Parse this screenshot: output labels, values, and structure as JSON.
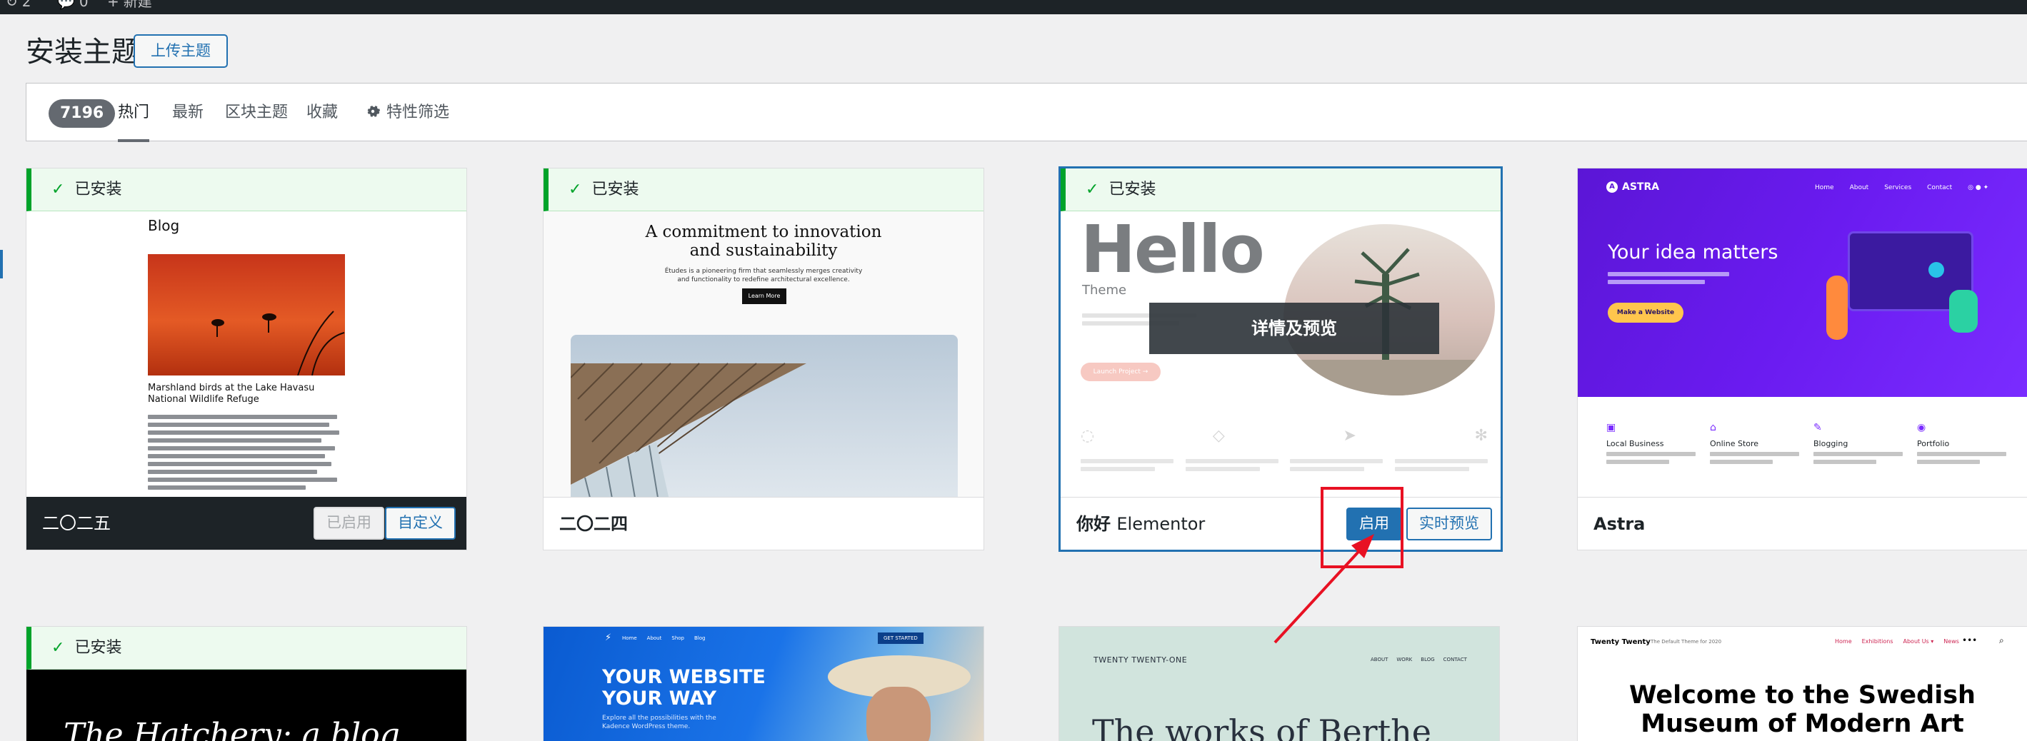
{
  "adminbar": {
    "item1": "2",
    "item2": "0",
    "new_label": "新建"
  },
  "header": {
    "title": "安装主题",
    "upload_label": "上传主题"
  },
  "filters": {
    "count": "7196",
    "tabs": [
      "热门",
      "最新",
      "区块主题",
      "收藏"
    ],
    "feature_filter": "特性筛选"
  },
  "colors": {
    "accent": "#2271b1",
    "installed_green": "#00a32a",
    "highlight_red": "#e81123"
  },
  "common": {
    "installed_label": "已安装",
    "overlay_label": "详情及预览"
  },
  "cards": [
    {
      "name": "二〇二五",
      "btn_activated": "已启用",
      "btn_customize": "自定义",
      "preview": {
        "heading": "Blog",
        "caption": "Marshland birds at the Lake Havasu National Wildlife Refuge"
      }
    },
    {
      "name": "二〇二四",
      "preview": {
        "headline_1": "A commitment to innovation",
        "headline_2": "and sustainability",
        "sub_1": "Études is a pioneering firm that seamlessly merges creativity",
        "sub_2": "and functionality to redefine architectural excellence.",
        "cta": "Learn More"
      }
    },
    {
      "name_cn": "你好",
      "name_en": "Elementor",
      "btn_activate": "启用",
      "btn_live_preview": "实时预览",
      "preview": {
        "big": "Hello",
        "sub": "Theme",
        "cta": "Launch Project →"
      }
    },
    {
      "name": "Astra",
      "preview": {
        "logo": "ASTRA",
        "nav": [
          "Home",
          "About",
          "Services",
          "Contact"
        ],
        "headline": "Your idea matters",
        "cta": "Make a Website",
        "features": [
          "Local Business",
          "Online Store",
          "Blogging",
          "Portfolio"
        ]
      }
    }
  ],
  "row2": [
    {
      "preview_text": "The Hatchery: a blog"
    },
    {
      "nav": [
        "Home",
        "About",
        "Shop",
        "Blog"
      ],
      "badge": "GET STARTED",
      "line1": "YOUR WEBSITE",
      "line2": "YOUR WAY",
      "sub_1": "Explore all the possibilities with the",
      "sub_2": "Kadence WordPress theme."
    },
    {
      "brand": "TWENTY TWENTY-ONE",
      "nav": [
        "ABOUT",
        "WORK",
        "BLOG",
        "CONTACT"
      ],
      "headline": "The works of Berthe"
    },
    {
      "brand": "Twenty Twenty",
      "tagline": "The Default Theme for 2020",
      "nav": [
        "Home",
        "Exhibitions",
        "About Us ▾",
        "News"
      ],
      "headline_1": "Welcome to the Swedish",
      "headline_2": "Museum of Modern Art"
    }
  ]
}
